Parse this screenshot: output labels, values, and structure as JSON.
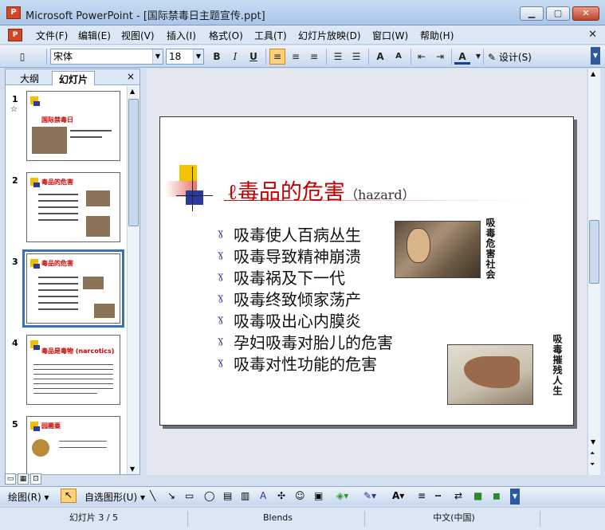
{
  "window": {
    "title": "Microsoft PowerPoint - [国际禁毒日主题宣传.ppt]",
    "icon_label": "P"
  },
  "menu": [
    "文件(F)",
    "编辑(E)",
    "视图(V)",
    "插入(I)",
    "格式(O)",
    "工具(T)",
    "幻灯片放映(D)",
    "窗口(W)",
    "帮助(H)"
  ],
  "toolbar": {
    "font_name": "宋体",
    "font_size": "18",
    "bold": "B",
    "italic": "I",
    "underline": "U",
    "design_label": "设计(S)"
  },
  "left_pane": {
    "tab_outline": "大纲",
    "tab_slides": "幻灯片",
    "close": "×",
    "thumbnails": [
      {
        "num": "1",
        "title": "国际禁毒日"
      },
      {
        "num": "2",
        "title": "毒品的危害"
      },
      {
        "num": "3",
        "title": "毒品的危害"
      },
      {
        "num": "4",
        "title": "毒品是毒物 (narcotics)"
      },
      {
        "num": "5",
        "title": "园罂粟"
      }
    ]
  },
  "slide": {
    "title": "毒品的危害",
    "title_symbol": "ℓ",
    "title_en": "（hazard）",
    "bullet_symbol": "ɣ",
    "bullets": [
      "吸毒使人百病丛生",
      "吸毒导致精神崩溃",
      "吸毒祸及下一代",
      "吸毒终致倾家荡产",
      "吸毒吸出心内膜炎",
      "孕妇吸毒对胎儿的危害",
      "吸毒对性功能的危害"
    ],
    "caption1": "吸毒危害社会",
    "caption2": "吸毒摧残人生"
  },
  "draw_toolbar": {
    "draw": "绘图(R)",
    "autoshapes": "自选图形(U)"
  },
  "status": {
    "slide_pos": "幻灯片 3 / 5",
    "design": "Blends",
    "language": "中文(中国)"
  }
}
